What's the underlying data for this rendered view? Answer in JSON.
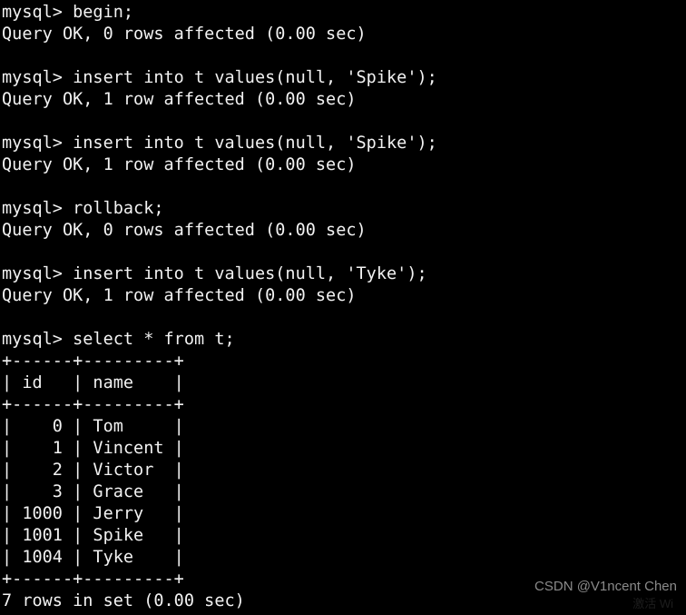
{
  "terminal": {
    "background_color": "#000000",
    "foreground_color": "#f2f2f2",
    "prompt": "mysql>",
    "lines": [
      "mysql> begin;",
      "Query OK, 0 rows affected (0.00 sec)",
      "",
      "mysql> insert into t values(null, 'Spike');",
      "Query OK, 1 row affected (0.00 sec)",
      "",
      "mysql> insert into t values(null, 'Spike');",
      "Query OK, 1 row affected (0.00 sec)",
      "",
      "mysql> rollback;",
      "Query OK, 0 rows affected (0.00 sec)",
      "",
      "mysql> insert into t values(null, 'Tyke');",
      "Query OK, 1 row affected (0.00 sec)",
      "",
      "mysql> select * from t;",
      "+------+---------+",
      "| id   | name    |",
      "+------+---------+",
      "|    0 | Tom     |",
      "|    1 | Vincent |",
      "|    2 | Victor  |",
      "|    3 | Grace   |",
      "| 1000 | Jerry   |",
      "| 1001 | Spike   |",
      "| 1004 | Tyke    |",
      "+------+---------+",
      "7 rows in set (0.00 sec)"
    ],
    "commands": [
      "begin;",
      "insert into t values(null, 'Spike');",
      "insert into t values(null, 'Spike');",
      "rollback;",
      "insert into t values(null, 'Tyke');",
      "select * from t;"
    ],
    "statuses": [
      "Query OK, 0 rows affected (0.00 sec)",
      "Query OK, 1 row affected (0.00 sec)",
      "Query OK, 1 row affected (0.00 sec)",
      "Query OK, 0 rows affected (0.00 sec)",
      "Query OK, 1 row affected (0.00 sec)"
    ],
    "result_table": {
      "columns": [
        "id",
        "name"
      ],
      "rows": [
        [
          "0",
          "Tom"
        ],
        [
          "1",
          "Vincent"
        ],
        [
          "2",
          "Victor"
        ],
        [
          "3",
          "Grace"
        ],
        [
          "1000",
          "Jerry"
        ],
        [
          "1001",
          "Spike"
        ],
        [
          "1004",
          "Tyke"
        ]
      ],
      "row_count_text": "7 rows in set (0.00 sec)",
      "row_count": 7,
      "elapsed": "0.00 sec"
    }
  },
  "watermark": {
    "text": "CSDN @V1ncent Chen",
    "sub_text": "激活 Wi",
    "color": "#8a8a8a"
  }
}
